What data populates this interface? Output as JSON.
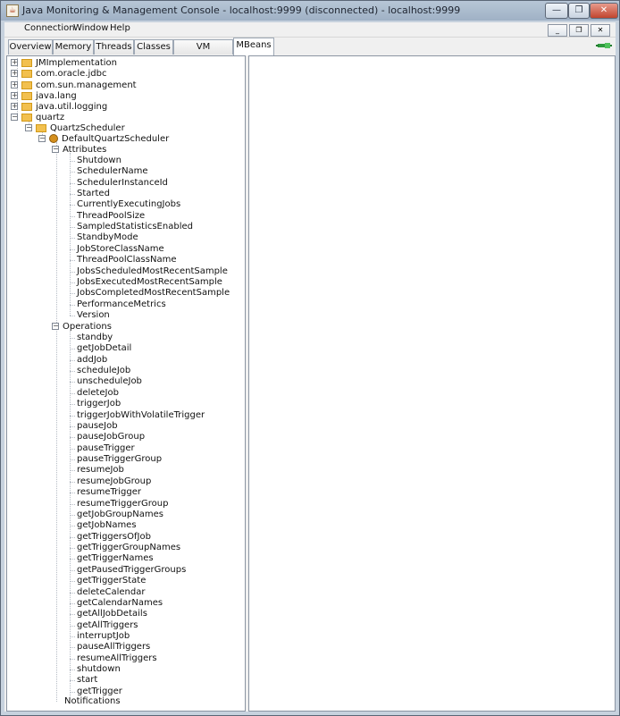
{
  "window": {
    "title": "Java Monitoring & Management Console - localhost:9999 (disconnected) - localhost:9999",
    "minimize": "—",
    "restore": "❐",
    "close": "✕"
  },
  "menu": {
    "connection": "Connection",
    "window": "Window",
    "help": "Help"
  },
  "tabs": [
    "Overview",
    "Memory",
    "Threads",
    "Classes",
    "VM Summary",
    "MBeans"
  ],
  "tree": {
    "roots": [
      {
        "label": "JMImplementation",
        "expanded": false
      },
      {
        "label": "com.oracle.jdbc",
        "expanded": false
      },
      {
        "label": "com.sun.management",
        "expanded": false
      },
      {
        "label": "java.lang",
        "expanded": false
      },
      {
        "label": "java.util.logging",
        "expanded": false
      },
      {
        "label": "quartz",
        "expanded": true
      }
    ],
    "quartz_scheduler": "QuartzScheduler",
    "default_scheduler": "DefaultQuartzScheduler",
    "attributes_label": "Attributes",
    "attributes": [
      "Shutdown",
      "SchedulerName",
      "SchedulerInstanceId",
      "Started",
      "CurrentlyExecutingJobs",
      "ThreadPoolSize",
      "SampledStatisticsEnabled",
      "StandbyMode",
      "JobStoreClassName",
      "ThreadPoolClassName",
      "JobsScheduledMostRecentSample",
      "JobsExecutedMostRecentSample",
      "JobsCompletedMostRecentSample",
      "PerformanceMetrics",
      "Version"
    ],
    "operations_label": "Operations",
    "operations": [
      "standby",
      "getJobDetail",
      "addJob",
      "scheduleJob",
      "unscheduleJob",
      "deleteJob",
      "triggerJob",
      "triggerJobWithVolatileTrigger",
      "pauseJob",
      "pauseJobGroup",
      "pauseTrigger",
      "pauseTriggerGroup",
      "resumeJob",
      "resumeJobGroup",
      "resumeTrigger",
      "resumeTriggerGroup",
      "getJobGroupNames",
      "getJobNames",
      "getTriggersOfJob",
      "getTriggerGroupNames",
      "getTriggerNames",
      "getPausedTriggerGroups",
      "getTriggerState",
      "deleteCalendar",
      "getCalendarNames",
      "getAllJobDetails",
      "getAllTriggers",
      "interruptJob",
      "pauseAllTriggers",
      "resumeAllTriggers",
      "shutdown",
      "start",
      "getTrigger"
    ],
    "notifications_label": "Notifications"
  }
}
